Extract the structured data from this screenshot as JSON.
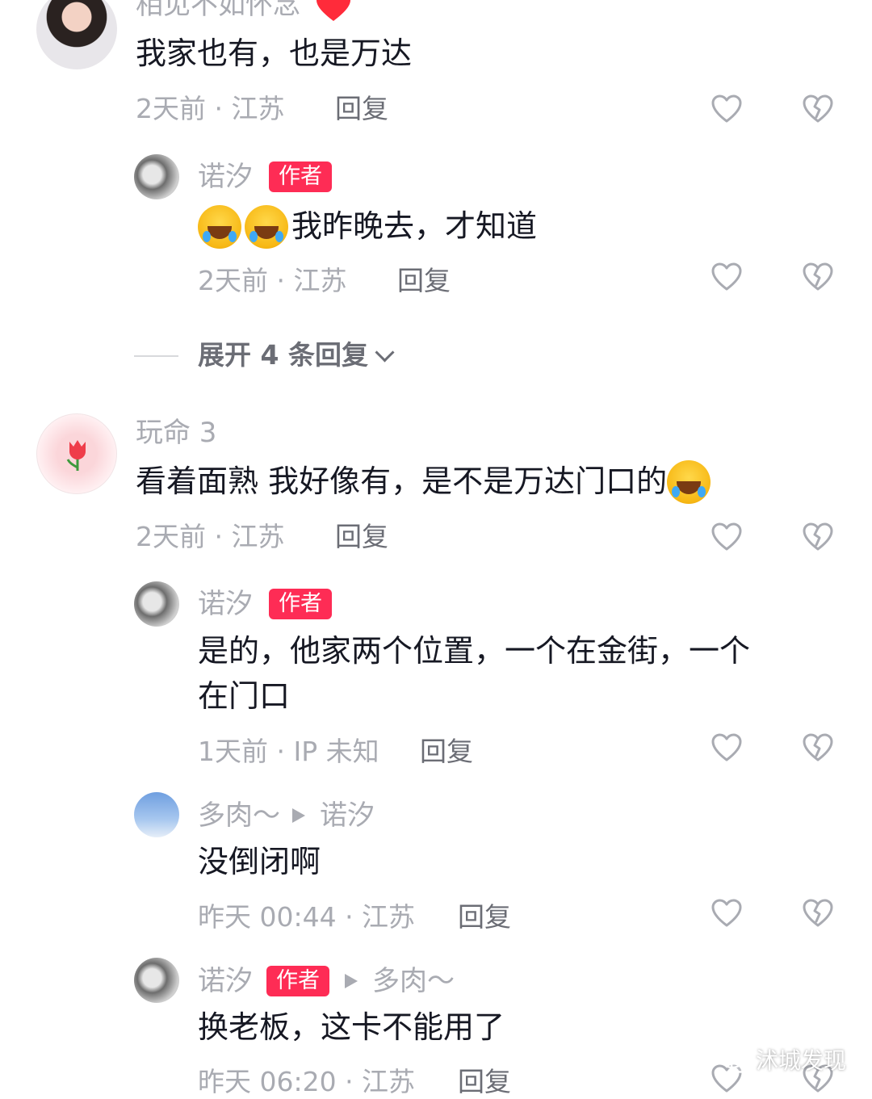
{
  "comments": [
    {
      "username": "相见不如怀念",
      "content": "我家也有，也是万达",
      "meta": "2天前 · 江苏",
      "reply_label": "回复"
    },
    {
      "username": "诺汐",
      "badge": "作者",
      "content": "我昨晚去，才知道",
      "emojis": [
        "laugh-cry-emoji",
        "laugh-cry-emoji"
      ],
      "meta": "2天前 · 江苏",
      "reply_label": "回复"
    },
    {
      "username": "玩命 3",
      "content": "看着面熟 我好像有，是不是万达门口的",
      "emojis": [
        "teary-eyed-emoji"
      ],
      "meta": "2天前 · 江苏",
      "reply_label": "回复"
    },
    {
      "username": "诺汐",
      "badge": "作者",
      "content_line1": "是的，他家两个位置，一个在金街，一个",
      "content_line2": "在门口",
      "meta": "1天前 · IP 未知",
      "reply_label": "回复"
    },
    {
      "username": "多肉～",
      "reply_to": "诺汐",
      "content": "没倒闭啊",
      "meta": "昨天 00:44 · 江苏",
      "reply_label": "回复"
    },
    {
      "username": "诺汐",
      "badge": "作者",
      "reply_to": "多肉～",
      "content": "换老板，这卡不能用了",
      "meta": "昨天 06:20 · 江苏",
      "reply_label": "回复"
    }
  ],
  "expand_replies": "展开 4 条回复",
  "watermark": "沭城发现",
  "colors": {
    "badge": "#fe2c55",
    "muted": "#a9abb2",
    "text": "#161823"
  },
  "icons": [
    "heart-icon",
    "broken-heart-icon",
    "chevron-down-icon",
    "wechat-icon"
  ]
}
